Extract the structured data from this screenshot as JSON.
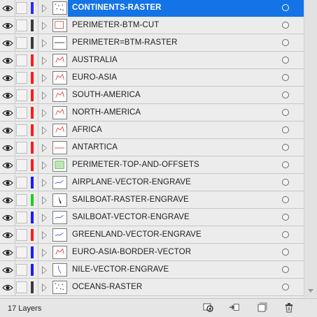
{
  "panel": {
    "layer_count_label": "17 Layers",
    "selected_layer_index": 0
  },
  "layers": [
    {
      "name": "CONTINENTS-RASTER",
      "color": "#2b2bff",
      "selected": true,
      "thumb": "dots"
    },
    {
      "name": "PERIMETER-BTM-CUT",
      "color": "#3a3a3a",
      "selected": false,
      "thumb": "box"
    },
    {
      "name": "PERIMETER=BTM-RASTER",
      "color": "#3a3a3a",
      "selected": false,
      "thumb": "line"
    },
    {
      "name": "AUSTRALIA",
      "color": "#ff1a1a",
      "selected": false,
      "thumb": "red"
    },
    {
      "name": "EURO-ASIA",
      "color": "#ff1a1a",
      "selected": false,
      "thumb": "red"
    },
    {
      "name": "SOUTH-AMERICA",
      "color": "#ff1a1a",
      "selected": false,
      "thumb": "red"
    },
    {
      "name": "NORTH-AMERICA",
      "color": "#ff1a1a",
      "selected": false,
      "thumb": "red"
    },
    {
      "name": "AFRICA",
      "color": "#ff1a1a",
      "selected": false,
      "thumb": "red"
    },
    {
      "name": "ANTARTICA",
      "color": "#ff1a1a",
      "selected": false,
      "thumb": "redline"
    },
    {
      "name": "PERIMETER-TOP-AND-OFFSETS",
      "color": "#ff1a1a",
      "selected": false,
      "thumb": "green"
    },
    {
      "name": "AIRPLANE-VECTOR-ENGRAVE",
      "color": "#1a1aff",
      "selected": false,
      "thumb": "blue"
    },
    {
      "name": "SAILBOAT-RASTER-ENGRAVE",
      "color": "#22cc22",
      "selected": false,
      "thumb": "black"
    },
    {
      "name": "SAILBOAT-VECTOR-ENGRAVE",
      "color": "#1a1aff",
      "selected": false,
      "thumb": "blue"
    },
    {
      "name": "GREENLAND-VECTOR-ENGRAVE",
      "color": "#ff1a1a",
      "selected": false,
      "thumb": "blue"
    },
    {
      "name": "EURO-ASIA-BORDER-VECTOR",
      "color": "#1a1aff",
      "selected": false,
      "thumb": "red"
    },
    {
      "name": "NILE-VECTOR-ENGRAVE",
      "color": "#1a1aff",
      "selected": false,
      "thumb": "blueline"
    },
    {
      "name": "OCEANS-RASTER",
      "color": "#3a3a3a",
      "selected": false,
      "thumb": "dots"
    }
  ],
  "footer": {
    "buttons": [
      {
        "icon": "locate-object-icon"
      },
      {
        "icon": "make-clipping-mask-icon"
      },
      {
        "icon": "create-sublayer-icon"
      },
      {
        "icon": "new-layer-icon"
      },
      {
        "icon": "trash-icon"
      }
    ]
  }
}
